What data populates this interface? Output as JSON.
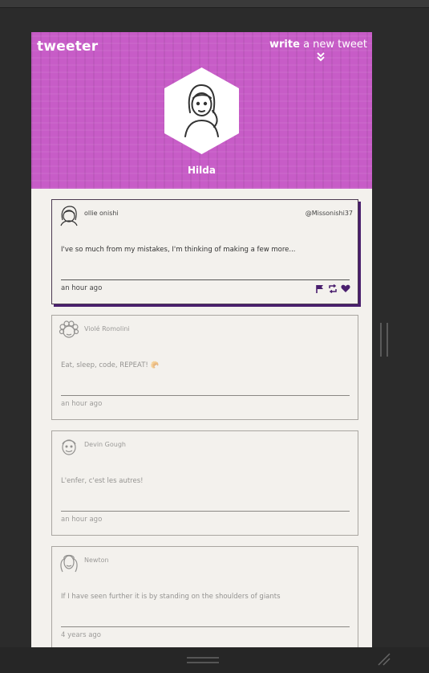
{
  "app": {
    "brand": "tweeter",
    "write_link_bold": "write",
    "write_link_rest": " a new tweet",
    "username": "Hilda"
  },
  "colors": {
    "header": "#c75cc7",
    "accent": "#4a1f6e",
    "card_bg": "#f3f1ed"
  },
  "tweets": [
    {
      "name": "ollie onishi",
      "handle": "@Missonishi37",
      "text": "I've so much from my mistakes, I'm thinking of making a few more...",
      "time": "an hour ago",
      "avatar_icon": "woman-face-icon"
    },
    {
      "name": "Violé Romolini",
      "handle": "",
      "text": "Eat, sleep, code, REPEAT! 🥐",
      "time": "an hour ago",
      "avatar_icon": "curly-hair-face-icon"
    },
    {
      "name": "Devin Gough",
      "handle": "",
      "text": "L'enfer, c'est les autres!",
      "time": "an hour ago",
      "avatar_icon": "man-face-icon"
    },
    {
      "name": "Newton",
      "handle": "",
      "text": "If I have seen further it is by standing on the shoulders of giants",
      "time": "4 years ago",
      "avatar_icon": "wig-face-icon"
    }
  ]
}
